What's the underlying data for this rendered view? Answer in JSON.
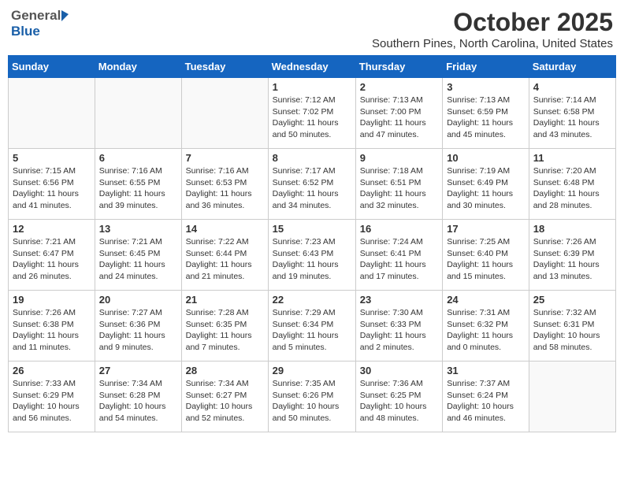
{
  "header": {
    "logo": {
      "general": "General",
      "blue": "Blue"
    },
    "month": "October 2025",
    "location": "Southern Pines, North Carolina, United States"
  },
  "weekdays": [
    "Sunday",
    "Monday",
    "Tuesday",
    "Wednesday",
    "Thursday",
    "Friday",
    "Saturday"
  ],
  "weeks": [
    [
      {
        "day": "",
        "info": ""
      },
      {
        "day": "",
        "info": ""
      },
      {
        "day": "",
        "info": ""
      },
      {
        "day": "1",
        "info": "Sunrise: 7:12 AM\nSunset: 7:02 PM\nDaylight: 11 hours\nand 50 minutes."
      },
      {
        "day": "2",
        "info": "Sunrise: 7:13 AM\nSunset: 7:00 PM\nDaylight: 11 hours\nand 47 minutes."
      },
      {
        "day": "3",
        "info": "Sunrise: 7:13 AM\nSunset: 6:59 PM\nDaylight: 11 hours\nand 45 minutes."
      },
      {
        "day": "4",
        "info": "Sunrise: 7:14 AM\nSunset: 6:58 PM\nDaylight: 11 hours\nand 43 minutes."
      }
    ],
    [
      {
        "day": "5",
        "info": "Sunrise: 7:15 AM\nSunset: 6:56 PM\nDaylight: 11 hours\nand 41 minutes."
      },
      {
        "day": "6",
        "info": "Sunrise: 7:16 AM\nSunset: 6:55 PM\nDaylight: 11 hours\nand 39 minutes."
      },
      {
        "day": "7",
        "info": "Sunrise: 7:16 AM\nSunset: 6:53 PM\nDaylight: 11 hours\nand 36 minutes."
      },
      {
        "day": "8",
        "info": "Sunrise: 7:17 AM\nSunset: 6:52 PM\nDaylight: 11 hours\nand 34 minutes."
      },
      {
        "day": "9",
        "info": "Sunrise: 7:18 AM\nSunset: 6:51 PM\nDaylight: 11 hours\nand 32 minutes."
      },
      {
        "day": "10",
        "info": "Sunrise: 7:19 AM\nSunset: 6:49 PM\nDaylight: 11 hours\nand 30 minutes."
      },
      {
        "day": "11",
        "info": "Sunrise: 7:20 AM\nSunset: 6:48 PM\nDaylight: 11 hours\nand 28 minutes."
      }
    ],
    [
      {
        "day": "12",
        "info": "Sunrise: 7:21 AM\nSunset: 6:47 PM\nDaylight: 11 hours\nand 26 minutes."
      },
      {
        "day": "13",
        "info": "Sunrise: 7:21 AM\nSunset: 6:45 PM\nDaylight: 11 hours\nand 24 minutes."
      },
      {
        "day": "14",
        "info": "Sunrise: 7:22 AM\nSunset: 6:44 PM\nDaylight: 11 hours\nand 21 minutes."
      },
      {
        "day": "15",
        "info": "Sunrise: 7:23 AM\nSunset: 6:43 PM\nDaylight: 11 hours\nand 19 minutes."
      },
      {
        "day": "16",
        "info": "Sunrise: 7:24 AM\nSunset: 6:41 PM\nDaylight: 11 hours\nand 17 minutes."
      },
      {
        "day": "17",
        "info": "Sunrise: 7:25 AM\nSunset: 6:40 PM\nDaylight: 11 hours\nand 15 minutes."
      },
      {
        "day": "18",
        "info": "Sunrise: 7:26 AM\nSunset: 6:39 PM\nDaylight: 11 hours\nand 13 minutes."
      }
    ],
    [
      {
        "day": "19",
        "info": "Sunrise: 7:26 AM\nSunset: 6:38 PM\nDaylight: 11 hours\nand 11 minutes."
      },
      {
        "day": "20",
        "info": "Sunrise: 7:27 AM\nSunset: 6:36 PM\nDaylight: 11 hours\nand 9 minutes."
      },
      {
        "day": "21",
        "info": "Sunrise: 7:28 AM\nSunset: 6:35 PM\nDaylight: 11 hours\nand 7 minutes."
      },
      {
        "day": "22",
        "info": "Sunrise: 7:29 AM\nSunset: 6:34 PM\nDaylight: 11 hours\nand 5 minutes."
      },
      {
        "day": "23",
        "info": "Sunrise: 7:30 AM\nSunset: 6:33 PM\nDaylight: 11 hours\nand 2 minutes."
      },
      {
        "day": "24",
        "info": "Sunrise: 7:31 AM\nSunset: 6:32 PM\nDaylight: 11 hours\nand 0 minutes."
      },
      {
        "day": "25",
        "info": "Sunrise: 7:32 AM\nSunset: 6:31 PM\nDaylight: 10 hours\nand 58 minutes."
      }
    ],
    [
      {
        "day": "26",
        "info": "Sunrise: 7:33 AM\nSunset: 6:29 PM\nDaylight: 10 hours\nand 56 minutes."
      },
      {
        "day": "27",
        "info": "Sunrise: 7:34 AM\nSunset: 6:28 PM\nDaylight: 10 hours\nand 54 minutes."
      },
      {
        "day": "28",
        "info": "Sunrise: 7:34 AM\nSunset: 6:27 PM\nDaylight: 10 hours\nand 52 minutes."
      },
      {
        "day": "29",
        "info": "Sunrise: 7:35 AM\nSunset: 6:26 PM\nDaylight: 10 hours\nand 50 minutes."
      },
      {
        "day": "30",
        "info": "Sunrise: 7:36 AM\nSunset: 6:25 PM\nDaylight: 10 hours\nand 48 minutes."
      },
      {
        "day": "31",
        "info": "Sunrise: 7:37 AM\nSunset: 6:24 PM\nDaylight: 10 hours\nand 46 minutes."
      },
      {
        "day": "",
        "info": ""
      }
    ]
  ]
}
